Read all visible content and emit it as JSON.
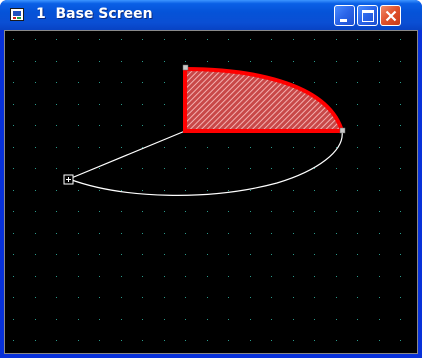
{
  "window": {
    "title": "1  Base Screen"
  },
  "icons": {
    "app": "app-screen-icon",
    "minimize": "minimize-icon",
    "maximize": "maximize-icon",
    "close": "close-icon"
  },
  "colors": {
    "title_bar": "#0553d8",
    "canvas_background": "#000000",
    "grid_dots": "#2a9a8a",
    "selected_shape_outline": "#ff0000",
    "selected_shape_hatch": "#f4a0a0",
    "curve": "#ffffff"
  }
}
